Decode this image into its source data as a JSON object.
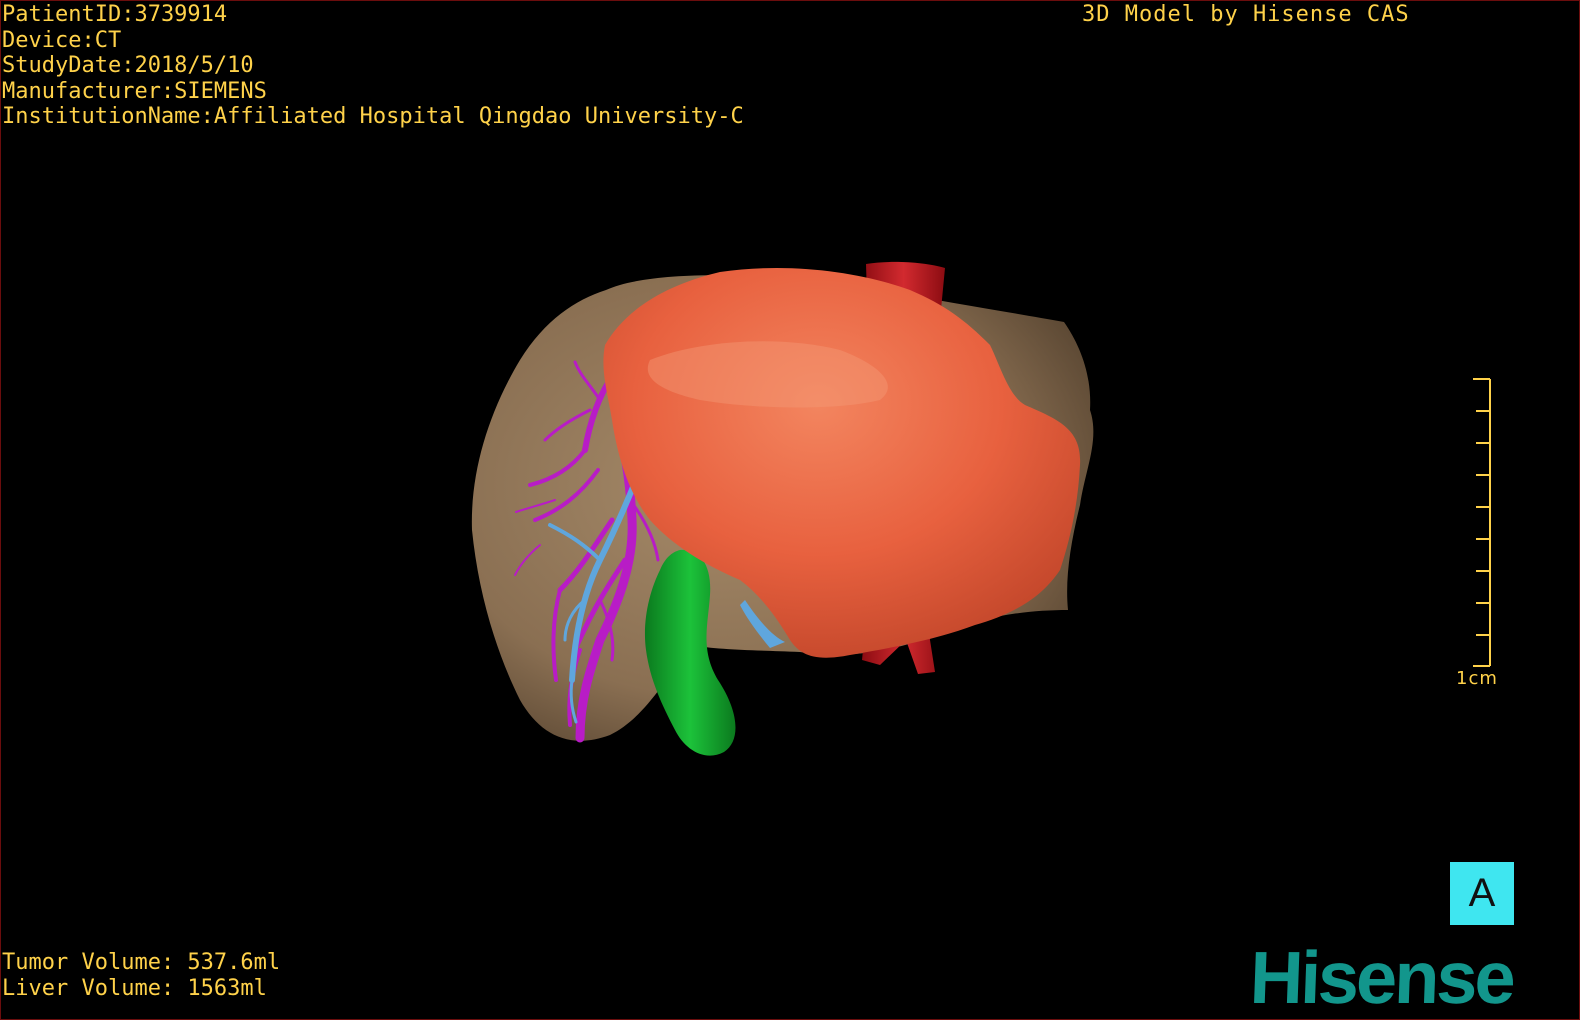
{
  "header": {
    "patient_id": "PatientID:3739914",
    "device": "Device:CT",
    "study_date": "StudyDate:2018/5/10",
    "manufacturer": "Manufacturer:SIEMENS",
    "institution": "InstitutionName:Affiliated Hospital Qingdao University-C",
    "model_credit": "3D Model by Hisense CAS"
  },
  "volumes": {
    "tumor": "Tumor Volume: 537.6ml",
    "liver": "Liver Volume: 1563ml"
  },
  "scale": {
    "label": "1cm"
  },
  "orientation": {
    "label": "A"
  },
  "brand": {
    "logo_text": "Hisense"
  },
  "colors": {
    "overlay_text": "#ffd24a",
    "background": "#000000",
    "liver": "#8f7556",
    "tumor": "#e8613f",
    "portal_vein": "#b81cc6",
    "hepatic_vein": "#5fa6dd",
    "ivc_aorta": "#c2141c",
    "gallbladder": "#13a22b",
    "orientation_cube": "#3fe6f0",
    "brand": "#12968c"
  }
}
